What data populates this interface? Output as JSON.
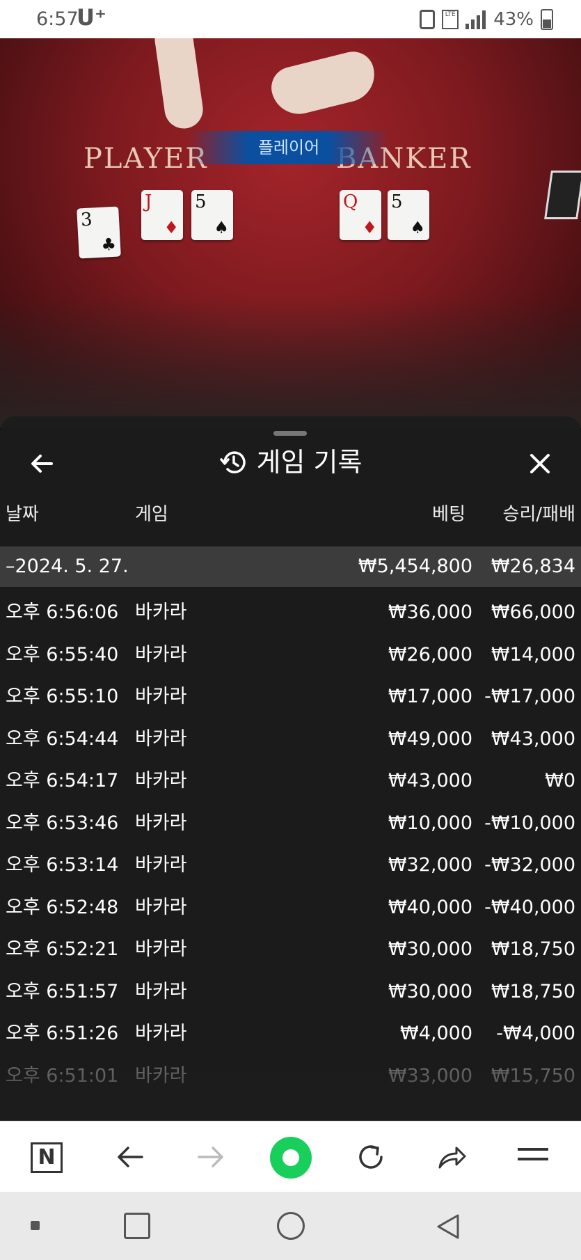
{
  "status_bar": {
    "time": "6:57",
    "carrier": "U⁺",
    "battery": "43%"
  },
  "video": {
    "player_label": "PLAYER",
    "banker_label": "BANKER",
    "banner": "플레이어",
    "player_cards": [
      {
        "rank": "3",
        "suit": "♣",
        "red": false
      },
      {
        "rank": "J",
        "suit": "♦",
        "red": true
      },
      {
        "rank": "5",
        "suit": "♠",
        "red": false
      }
    ],
    "banker_cards": [
      {
        "rank": "Q",
        "suit": "♦",
        "red": true
      },
      {
        "rank": "5",
        "suit": "♠",
        "red": false
      }
    ]
  },
  "history_panel": {
    "title": "게임 기록",
    "columns": {
      "date": "날짜",
      "game": "게임",
      "bet": "베팅",
      "win_loss": "승리/패배"
    },
    "date_group": {
      "date": "–2024. 5. 27.",
      "bet_total": "₩5,454,800",
      "win_total": "₩26,834"
    },
    "rows": [
      {
        "time": "오후 6:56:06",
        "game": "바카라",
        "bet": "₩36,000",
        "result": "₩66,000"
      },
      {
        "time": "오후 6:55:40",
        "game": "바카라",
        "bet": "₩26,000",
        "result": "₩14,000"
      },
      {
        "time": "오후 6:55:10",
        "game": "바카라",
        "bet": "₩17,000",
        "result": "-₩17,000"
      },
      {
        "time": "오후 6:54:44",
        "game": "바카라",
        "bet": "₩49,000",
        "result": "₩43,000"
      },
      {
        "time": "오후 6:54:17",
        "game": "바카라",
        "bet": "₩43,000",
        "result": "₩0"
      },
      {
        "time": "오후 6:53:46",
        "game": "바카라",
        "bet": "₩10,000",
        "result": "-₩10,000"
      },
      {
        "time": "오후 6:53:14",
        "game": "바카라",
        "bet": "₩32,000",
        "result": "-₩32,000"
      },
      {
        "time": "오후 6:52:48",
        "game": "바카라",
        "bet": "₩40,000",
        "result": "-₩40,000"
      },
      {
        "time": "오후 6:52:21",
        "game": "바카라",
        "bet": "₩30,000",
        "result": "₩18,750"
      },
      {
        "time": "오후 6:51:57",
        "game": "바카라",
        "bet": "₩30,000",
        "result": "₩18,750"
      },
      {
        "time": "오후 6:51:26",
        "game": "바카라",
        "bet": "₩4,000",
        "result": "-₩4,000"
      },
      {
        "time": "오후 6:51:01",
        "game": "바카라",
        "bet": "₩33,000",
        "result": "₩15,750"
      }
    ]
  },
  "icons": {
    "back": "arrow-left-icon",
    "close": "close-icon",
    "history": "history-icon"
  }
}
